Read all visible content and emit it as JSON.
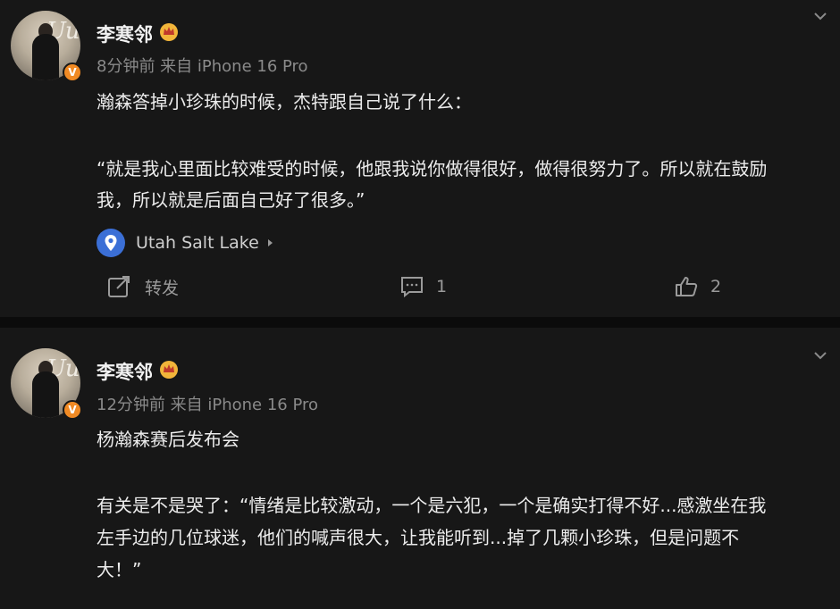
{
  "posts": [
    {
      "user": {
        "name": "李寒邻",
        "verified_badge": "V",
        "crown_icon": "crown-icon"
      },
      "meta": "8分钟前  来自 iPhone 16 Pro",
      "body_line1": "瀚森答掉小珍珠的时候，杰特跟自己说了什么：",
      "body_line2": "“就是我心里面比较难受的时候，他跟我说你做得很好，做得很努力了。所以就在鼓励",
      "body_line3": "我，所以就是后面自己好了很多。”",
      "location": "Utah Salt Lake",
      "actions": {
        "repost": "转发",
        "comments": "1",
        "likes": "2"
      }
    },
    {
      "user": {
        "name": "李寒邻",
        "verified_badge": "V",
        "crown_icon": "crown-icon"
      },
      "meta": "12分钟前  来自 iPhone 16 Pro",
      "body_line1": "杨瀚森赛后发布会",
      "body_line2": "有关是不是哭了：“情绪是比较激动，一个是六犯，一个是确实打得不好...感激坐在我",
      "body_line3": "左手边的几位球迷，他们的喊声很大，让我能听到...掉了几颗小珍珠，但是问题不",
      "body_line4": "大！”"
    }
  ],
  "colors": {
    "background": "#171717",
    "verify": "#f08a24",
    "location_icon": "#3b6fd6"
  }
}
